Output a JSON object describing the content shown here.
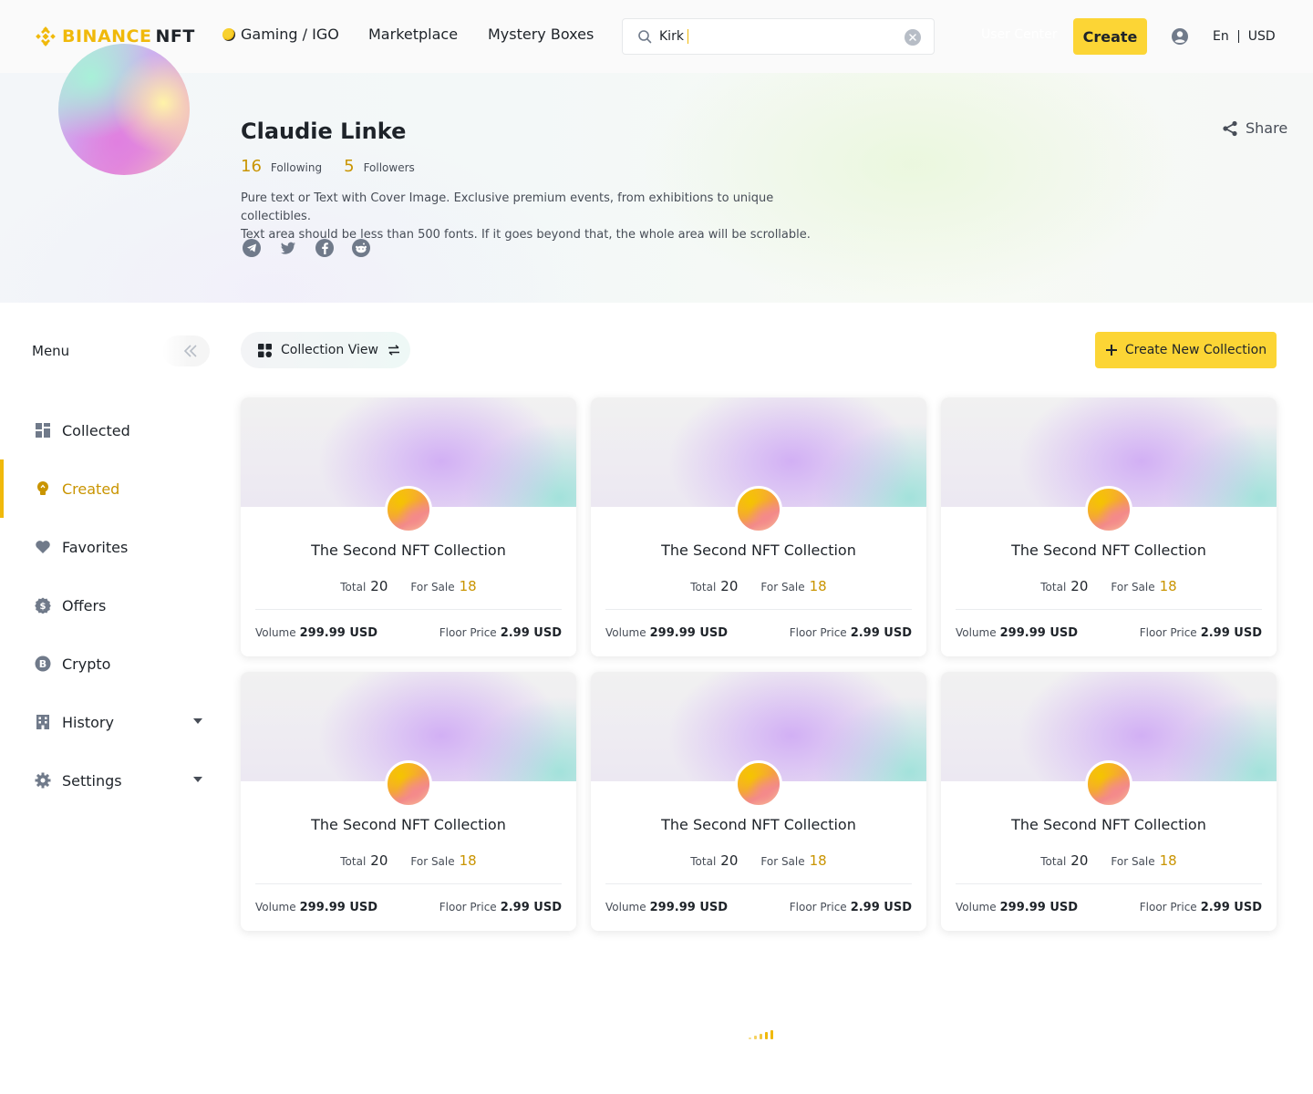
{
  "header": {
    "logo_brand": "BINANCE",
    "logo_product": "NFT",
    "nav": [
      "Gaming / IGO",
      "Marketplace",
      "Mystery Boxes"
    ],
    "search_value": "Kirk",
    "user_center": "User Center",
    "create_label": "Create",
    "language": "En",
    "currency": "USD"
  },
  "profile": {
    "name": "Claudie Linke",
    "following_count": "16",
    "following_label": "Following",
    "followers_count": "5",
    "followers_label": "Followers",
    "bio_line1": "Pure text or Text with Cover Image. Exclusive premium events, from exhibitions to unique collectibles.",
    "bio_line2": "Text area should be less than 500 fonts. If it goes beyond that, the whole area will be scrollable.",
    "socials": [
      "telegram-icon",
      "twitter-icon",
      "facebook-icon",
      "reddit-icon"
    ],
    "share_label": "Share"
  },
  "sidebar": {
    "title": "Menu",
    "items": [
      {
        "label": "Collected",
        "icon": "grid-icon",
        "active": false
      },
      {
        "label": "Created",
        "icon": "bulb-icon",
        "active": true
      },
      {
        "label": "Favorites",
        "icon": "heart-icon",
        "active": false
      },
      {
        "label": "Offers",
        "icon": "dollar-icon",
        "active": false
      },
      {
        "label": "Crypto",
        "icon": "bitcoin-icon",
        "active": false
      },
      {
        "label": "History",
        "icon": "building-icon",
        "active": false,
        "expandable": true
      },
      {
        "label": "Settings",
        "icon": "gear-icon",
        "active": false,
        "expandable": true
      }
    ]
  },
  "toolbar": {
    "view_label": "Collection View",
    "new_collection_label": "Create New Collection"
  },
  "collections": [
    {
      "title": "The Second NFT Collection",
      "total_label": "Total",
      "total": "20",
      "sale_label": "For Sale",
      "for_sale": "18",
      "volume_label": "Volume",
      "volume": "299.99 USD",
      "floor_label": "Floor Price",
      "floor": "2.99 USD"
    },
    {
      "title": "The Second NFT Collection",
      "total_label": "Total",
      "total": "20",
      "sale_label": "For Sale",
      "for_sale": "18",
      "volume_label": "Volume",
      "volume": "299.99 USD",
      "floor_label": "Floor Price",
      "floor": "2.99 USD"
    },
    {
      "title": "The Second NFT Collection",
      "total_label": "Total",
      "total": "20",
      "sale_label": "For Sale",
      "for_sale": "18",
      "volume_label": "Volume",
      "volume": "299.99 USD",
      "floor_label": "Floor Price",
      "floor": "2.99 USD"
    },
    {
      "title": "The Second NFT Collection",
      "total_label": "Total",
      "total": "20",
      "sale_label": "For Sale",
      "for_sale": "18",
      "volume_label": "Volume",
      "volume": "299.99 USD",
      "floor_label": "Floor Price",
      "floor": "2.99 USD"
    },
    {
      "title": "The Second NFT Collection",
      "total_label": "Total",
      "total": "20",
      "sale_label": "For Sale",
      "for_sale": "18",
      "volume_label": "Volume",
      "volume": "299.99 USD",
      "floor_label": "Floor Price",
      "floor": "2.99 USD"
    },
    {
      "title": "The Second NFT Collection",
      "total_label": "Total",
      "total": "20",
      "sale_label": "For Sale",
      "for_sale": "18",
      "volume_label": "Volume",
      "volume": "299.99 USD",
      "floor_label": "Floor Price",
      "floor": "2.99 USD"
    }
  ],
  "colors": {
    "brand_yellow": "#fcd535",
    "accent_gold": "#c99400",
    "text_primary": "#1e2329",
    "text_secondary": "#474d57"
  }
}
